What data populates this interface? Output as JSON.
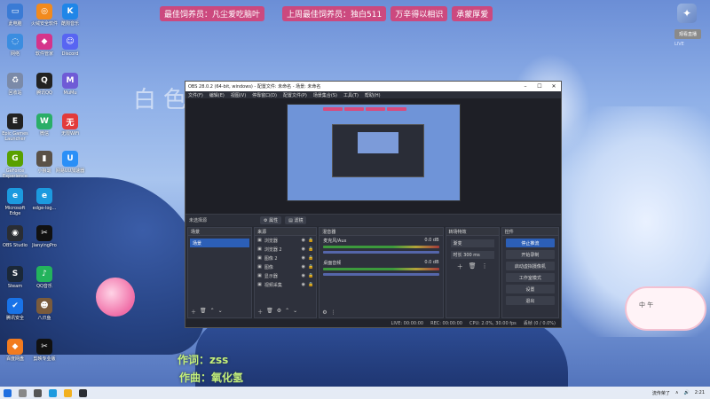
{
  "banner": {
    "left": [
      "最佳饲养员：凡尘爱吃脑叶"
    ],
    "middle": [
      "上周最佳饲养员：独白511",
      "万辛得以相识",
      "承蒙厚爱"
    ]
  },
  "right_widget": {
    "button": "观看直播",
    "sub": "LIVE"
  },
  "desktop_icons": [
    {
      "label": "此电脑",
      "color": "#3a7bd5",
      "glyph": "▭"
    },
    {
      "label": "火绒安全软件",
      "color": "#f28a1d",
      "glyph": "◎"
    },
    {
      "label": "酷狗音乐",
      "color": "#1f86e8",
      "glyph": "K"
    },
    {
      "label": "网络",
      "color": "#3b8de0",
      "glyph": "◌"
    },
    {
      "label": "软件管家",
      "color": "#d5348b",
      "glyph": "◆"
    },
    {
      "label": "Discord",
      "color": "#5865f2",
      "glyph": "☺"
    },
    {
      "label": "回收站",
      "color": "#7b8aa8",
      "glyph": "♻"
    },
    {
      "label": "腾讯QQ",
      "color": "#222",
      "glyph": "Q"
    },
    {
      "label": "MuMu",
      "color": "#6f5bd6",
      "glyph": "M"
    },
    {
      "label": "Epic Games Launcher",
      "color": "#222",
      "glyph": "E"
    },
    {
      "label": "微信",
      "color": "#2aae67",
      "glyph": "W"
    },
    {
      "label": "无限WiFi",
      "color": "#e33b3b",
      "glyph": "无"
    },
    {
      "label": "GeForce Experience",
      "color": "#59a000",
      "glyph": "G"
    },
    {
      "label": "小狼毫",
      "color": "#5a5147",
      "glyph": "▮"
    },
    {
      "label": "网易UU加速器",
      "color": "#2a8ff7",
      "glyph": "U"
    },
    {
      "label": "Microsoft Edge",
      "color": "#1c9adf",
      "glyph": "e"
    },
    {
      "label": "edge-log...",
      "color": "#1c9adf",
      "glyph": "e"
    },
    {
      "label": "OBS Studio",
      "color": "#2a2d33",
      "glyph": "◉"
    },
    {
      "label": "JianyingPro",
      "color": "#111",
      "glyph": "✂"
    },
    {
      "label": "Steam",
      "color": "#1b2838",
      "glyph": "S"
    },
    {
      "label": "QQ音乐",
      "color": "#23b35c",
      "glyph": "♪"
    },
    {
      "label": "腾讯安全",
      "color": "#1973e8",
      "glyph": "✔"
    },
    {
      "label": "八爪鱼",
      "color": "#7a5b3c",
      "glyph": "☻"
    },
    {
      "label": "百度网盘",
      "color": "#f27b1e",
      "glyph": "◆"
    },
    {
      "label": "剪映专业版",
      "color": "#111",
      "glyph": "✂"
    }
  ],
  "obs": {
    "title": "OBS 28.0.2 (64-bit, windows) - 配置文件: 未命名 - 场景: 未命名",
    "menu": [
      "文件(F)",
      "编辑(E)",
      "视图(V)",
      "停靠窗口(D)",
      "配置文件(P)",
      "场景集合(S)",
      "工具(T)",
      "帮助(H)"
    ],
    "no_source": "未选择源",
    "props_btn": "属性",
    "filter_btn": "滤镜",
    "scenes": {
      "title": "场景",
      "selected": "场景"
    },
    "sources": {
      "title": "来源",
      "items": [
        "浏览器",
        "浏览器 2",
        "图像 2",
        "图像",
        "显示器",
        "视频采集"
      ]
    },
    "mixer": {
      "title": "混音器",
      "tracks": [
        {
          "name": "麦克风/Aux",
          "db": "0.0 dB"
        },
        {
          "name": "桌面音频",
          "db": "0.0 dB"
        }
      ]
    },
    "transitions": {
      "title": "转场特效",
      "selected": "渐变",
      "duration_label": "时长",
      "duration": "300 ms"
    },
    "controls": {
      "title": "控件",
      "buttons": [
        "停止推流",
        "开始录制",
        "启动虚拟摄像机",
        "工作室模式",
        "设置",
        "退出"
      ]
    },
    "status": {
      "live": "LIVE: 00:00:00",
      "rec": "REC: 00:00:00",
      "cpu": "CPU: 2.0%, 30.00 fps",
      "dropped": "丢帧 (0 / 0.0%)"
    }
  },
  "lyrics": {
    "line1": "作词：zss",
    "line2": "作曲：氧化氢"
  },
  "sticker": {
    "text": "中 午"
  },
  "taskbar": {
    "tray": [
      "流传荣了",
      "∧",
      "🔊",
      "2:21"
    ]
  },
  "overlay_title": "白色"
}
